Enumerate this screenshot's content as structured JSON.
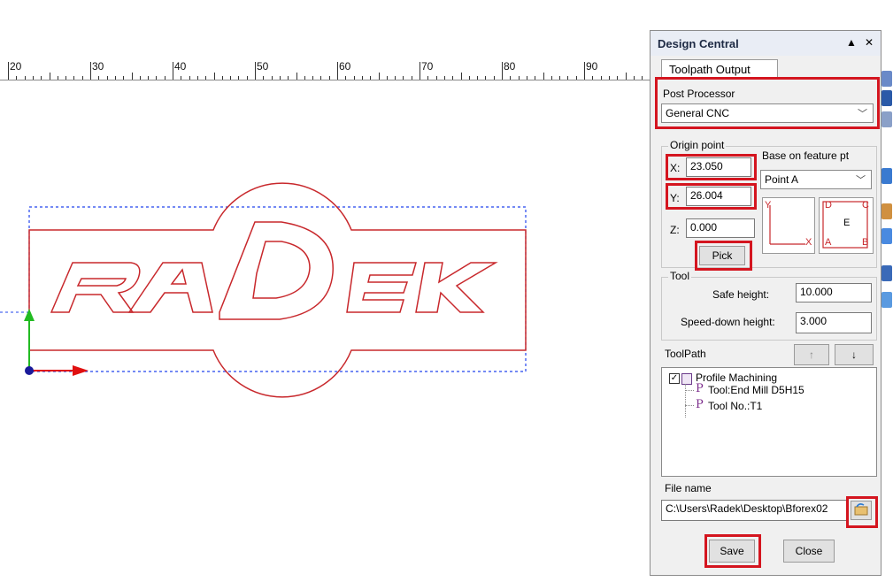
{
  "ruler": {
    "labels": [
      "20",
      "30",
      "40",
      "50",
      "60",
      "70",
      "80",
      "90"
    ]
  },
  "panel": {
    "title": "Design Central",
    "collapse_icon": "triangle-up-icon",
    "close_icon": "close-icon",
    "tab_label": "Toolpath Output",
    "post_processor_label": "Post Processor",
    "post_processor_value": "General CNC",
    "origin_point_label": "Origin point",
    "x_label": "X:",
    "x_value": "23.050",
    "y_label": "Y:",
    "y_value": "26.004",
    "z_label": "Z:",
    "z_value": "0.000",
    "pick_label": "Pick",
    "feature_label": "Base on feature pt",
    "feature_value": "Point A",
    "diagram_left": {
      "y": "Y",
      "x": "X"
    },
    "diagram_right": {
      "a": "A",
      "b": "B",
      "c": "C",
      "d": "D",
      "e": "E"
    },
    "tool_label": "Tool",
    "safe_height_label": "Safe height:",
    "safe_height_value": "10.000",
    "speed_down_label": "Speed-down height:",
    "speed_down_value": "3.000",
    "toolpath_label": "ToolPath",
    "up_arrow": "↑",
    "down_arrow": "↓",
    "tree": {
      "root": "Profile Machining",
      "child1_icon": "P",
      "child1": "Tool:End Mill D5H15",
      "child2_icon": "P",
      "child2": "Tool No.:T1"
    },
    "file_name_label": "File name",
    "file_path": "C:\\Users\\Radek\\Desktop\\Bforex02",
    "save_label": "Save",
    "close_label": "Close"
  },
  "canvas": {
    "logo_text": "RADEK"
  },
  "colors": {
    "highlight": "#d4151f",
    "outline": "#c8282c",
    "selection": "#2244ee",
    "axis_x": "#e01010",
    "axis_y": "#22bb22"
  }
}
